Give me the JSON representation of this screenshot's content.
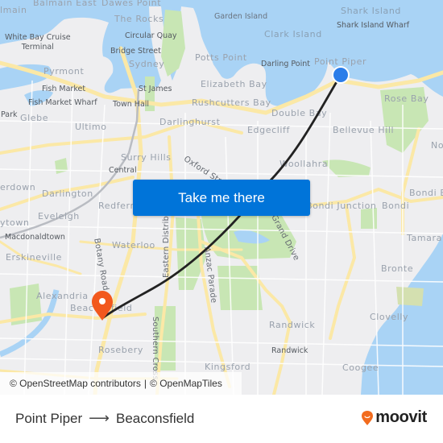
{
  "map": {
    "origin_label": "Point Piper",
    "destination_label": "Beaconsfield",
    "colors": {
      "water": "#a9d3f5",
      "land": "#eeeef0",
      "park": "#c8e6b4",
      "major_road": "#fbe8a6",
      "route": "#222222",
      "origin_marker": "#2b7de9",
      "destination_marker": "#f2581d",
      "button": "#0074d9"
    },
    "labels": {
      "balmain_east": "Balmain East",
      "dawes_point": "Dawes Point",
      "the_rocks": "The Rocks",
      "balmain": "lmain",
      "white_bay": "White Bay Cruise\nTerminal",
      "circular_quay": "Circular Quay",
      "bridge_street": "Bridge Street",
      "sydney": "Sydney",
      "pyrmont": "Pyrmont",
      "fish_market": "Fish Market",
      "fish_market_wharf": "Fish Market Wharf",
      "st_james": "St James",
      "town_hall": "Town Hall",
      "park": "Park",
      "glebe": "Glebe",
      "ultimo": "Ultimo",
      "darlinghurst": "Darlinghurst",
      "potts_point": "Potts Point",
      "elizabeth_bay": "Elizabeth Bay",
      "rushcutters_bay": "Rushcutters Bay",
      "garden_island": "Garden Island",
      "clark_island": "Clark Island",
      "shark_island": "Shark Island",
      "shark_island_wharf": "Shark Island Wharf",
      "darling_point": "Darling Point",
      "point_piper": "Point Piper",
      "double_bay": "Double Bay",
      "rose_bay": "Rose Bay",
      "edgecliff": "Edgecliff",
      "bellevue_hill": "Bellevue Hill",
      "north": "No",
      "oxford_street": "Oxford Street",
      "surry_hills": "Surry Hills",
      "central": "Central",
      "woollahra": "Woollahra",
      "erdown": "erdown",
      "darlington": "Darlington",
      "redfern": "Redfern",
      "bondi_junction": "Bondi Junction",
      "bondi": "Bondi",
      "bondi_beach": "Bondi B",
      "eveleigh": "Eveleigh",
      "ytown": "ytown",
      "macdonaldtown": "Macdonaldtown",
      "eastern_distributor": "Eastern Distrib",
      "grand_drive": "Grand Drive",
      "tamarama": "Tamaram",
      "erskineville": "Erskineville",
      "waterloo": "Waterloo",
      "botany_road": "Botany Road",
      "anzac_parade": "Anzac Parade",
      "bronte": "Bronte",
      "alexandria": "Alexandria",
      "beaconsfield": "Beaconsfield",
      "southern_cross": "Southern Cross",
      "randwick_suburb": "Randwick",
      "clovelly": "Clovelly",
      "randwick_station": "Randwick",
      "rosebery": "Rosebery",
      "kingsford": "Kingsford",
      "coogee": "Coogee"
    },
    "cta_label": "Take me there",
    "attribution": {
      "osm": "© OpenStreetMap contributors",
      "separator": "|",
      "omt": "© OpenMapTiles"
    }
  },
  "footer": {
    "origin": "Point Piper",
    "arrow": "⟶",
    "destination": "Beaconsfield",
    "brand": "moovit",
    "brand_icon": "moovit-pin-icon"
  }
}
